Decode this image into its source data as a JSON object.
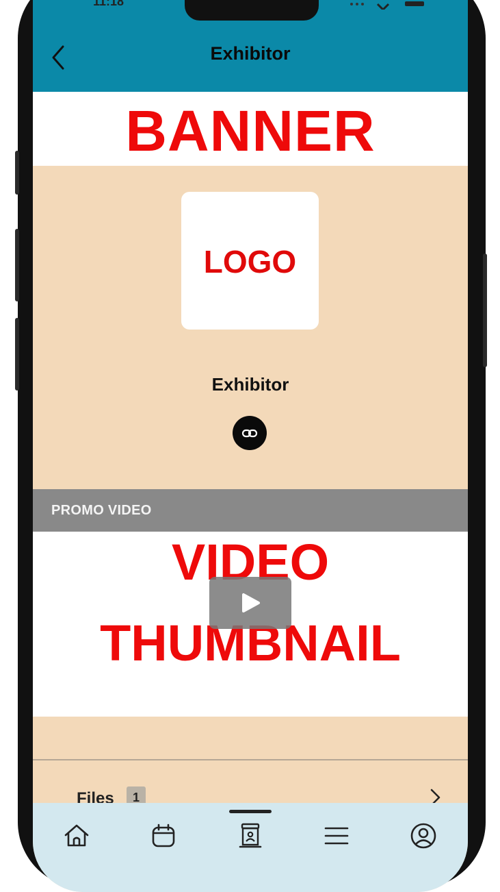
{
  "header": {
    "title": "Exhibitor"
  },
  "banner": {
    "text": "BANNER"
  },
  "logo": {
    "text": "LOGO"
  },
  "exhibitor": {
    "name": "Exhibitor"
  },
  "promo": {
    "section_label": "PROMO VIDEO",
    "thumbnail_line1": "VIDEO",
    "thumbnail_line2": "THUMBNAIL"
  },
  "files": {
    "label": "Files",
    "count": "1"
  },
  "tabs": [
    {
      "icon": "home-icon"
    },
    {
      "icon": "calendar-icon"
    },
    {
      "icon": "exhibitor-booth-icon",
      "active": true
    },
    {
      "icon": "menu-icon"
    },
    {
      "icon": "profile-icon"
    }
  ],
  "colors": {
    "topbar": "#0b89a8",
    "content_background": "#f3d9b9",
    "placeholder_red": "#ee0a0a",
    "section_bar": "#898989",
    "tabbar": "#d3e8ef"
  }
}
